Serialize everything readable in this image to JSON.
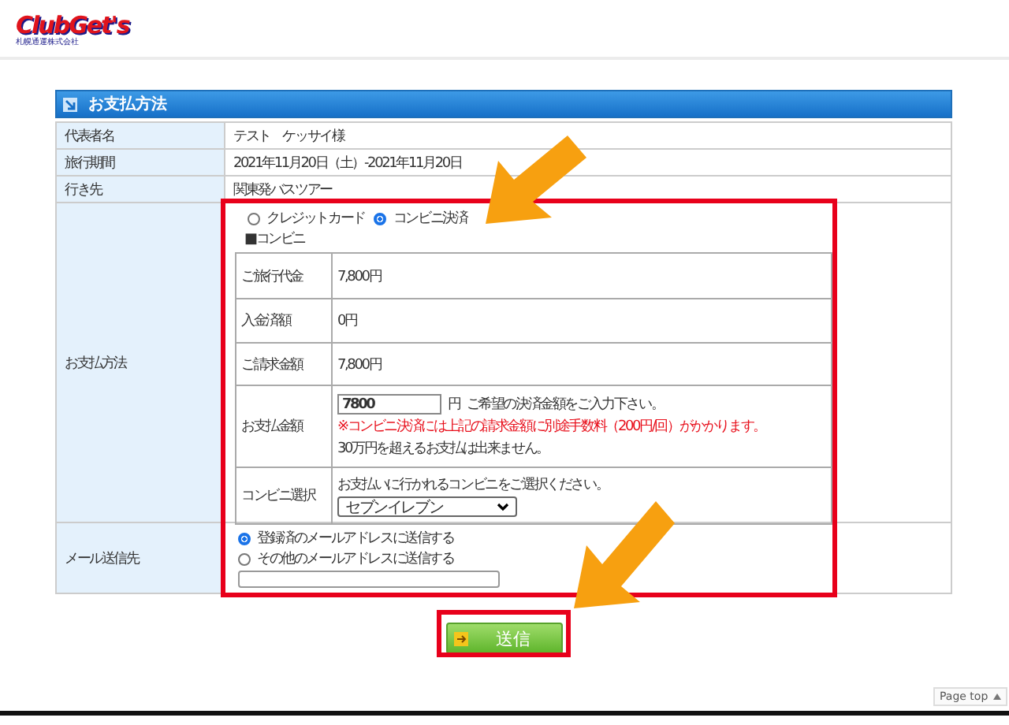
{
  "header": {
    "logo": "ClubGet's",
    "logo_sub": "札幌通運株式会社"
  },
  "section": {
    "title": "お支払方法"
  },
  "info_rows": [
    {
      "label": "代表者名",
      "value": "テスト　ケッサイ様"
    },
    {
      "label": "旅行期間",
      "value": "2021年11月20日（土）-2021年11月20日"
    },
    {
      "label": "行き先",
      "value": "関東発バスツアー"
    }
  ],
  "payment": {
    "label": "お支払方法",
    "methods": [
      {
        "label": "クレジットカード",
        "selected": false
      },
      {
        "label": "コンビニ決済",
        "selected": true
      }
    ],
    "subheading": "■コンビニ",
    "rows": [
      {
        "kind": "text",
        "label": "ご旅行代金",
        "value": "7,800円"
      },
      {
        "kind": "text",
        "label": "入金済額",
        "value": "0円"
      },
      {
        "kind": "text",
        "label": "ご請求金額",
        "value": "7,800円"
      },
      {
        "kind": "amount",
        "label": "お支払金額",
        "value": "7800",
        "unit": "円",
        "hint": "ご希望の決済金額をご入力下さい。",
        "warning": "※コンビニ決済には上記の請求金額に別途手数料（200円/回）がかかります。",
        "note": "30万円を超えるお支払は出来ません。"
      },
      {
        "kind": "select",
        "label": "コンビニ選択",
        "hint": "お支払いに行かれるコンビニをご選択ください。",
        "value": "セブンイレブン"
      }
    ]
  },
  "mail": {
    "label": "メール送信先",
    "options": [
      {
        "label": "登録済のメールアドレスに送信する",
        "selected": true
      },
      {
        "label": "その他のメールアドレスに送信する",
        "selected": false
      }
    ]
  },
  "submit": {
    "label": "送信"
  },
  "page_top": {
    "label": "Page top"
  }
}
